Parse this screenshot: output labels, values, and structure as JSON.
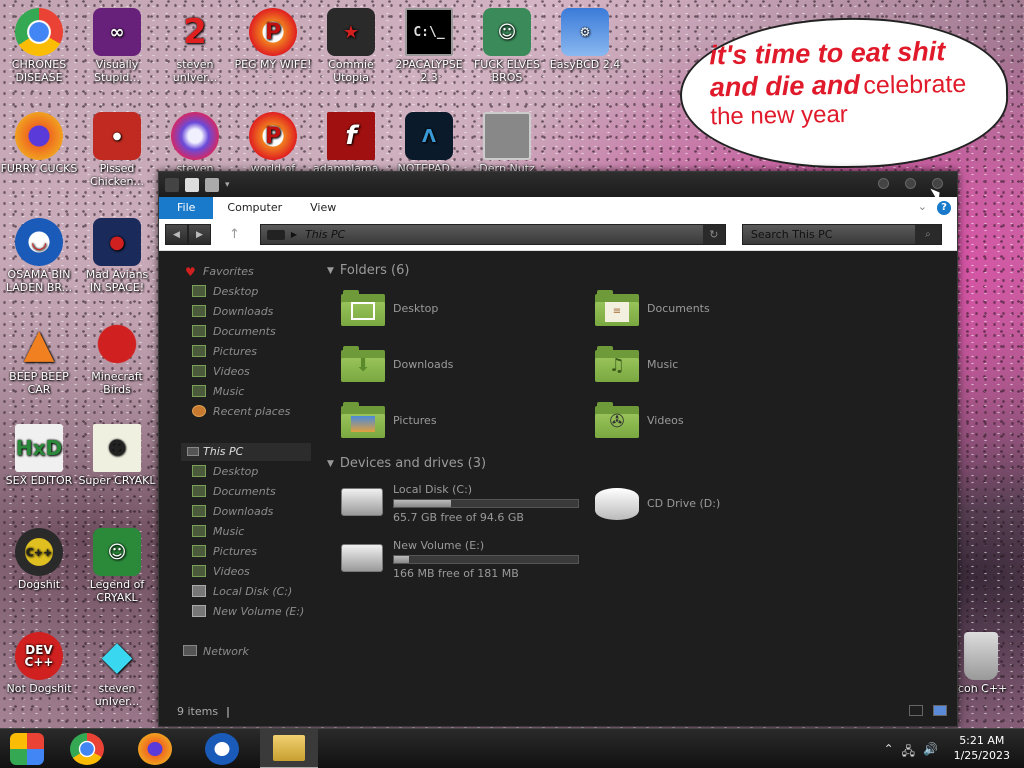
{
  "desktop": {
    "icons": [
      {
        "label": "CHRONES\nDISEASE",
        "icon": "chrome-icon"
      },
      {
        "label": "Visually\nStupid...",
        "icon": "visual-studio-icon"
      },
      {
        "label": "steven\nunIver...",
        "icon": "steven-icon"
      },
      {
        "label": "PEG MY WIFE!",
        "icon": "peggle-icon"
      },
      {
        "label": "Commie\nUtopia",
        "icon": "commie-utopia-icon"
      },
      {
        "label": "2PACALYPSE\n2.3",
        "icon": "terminal-icon"
      },
      {
        "label": "FUCK ELVES\nBROS",
        "icon": "elf-icon"
      },
      {
        "label": "EasyBCD 2.4",
        "icon": "easybcd-icon"
      },
      {
        "label": "FURRY CUCKS",
        "icon": "firefox-icon"
      },
      {
        "label": "Pissed\nChicken...",
        "icon": "angry-birds-seasons-icon"
      },
      {
        "label": "steven\nunIver...",
        "icon": "steven-gem-icon"
      },
      {
        "label": "world of\npe...",
        "icon": "world-of-peggle-icon"
      },
      {
        "label": "adamplama...",
        "icon": "flash-icon"
      },
      {
        "label": "NOTEPAD...",
        "icon": "notepad-icon"
      },
      {
        "label": "Derp Nutz",
        "icon": "derp-icon"
      },
      {
        "label": "OSAMA BIN\nLADEN BR...",
        "icon": "obama-icon"
      },
      {
        "label": "Mad Avians\nIN SPACE!",
        "icon": "angry-birds-space-icon"
      },
      {
        "label": "BEEP BEEP\nCAR",
        "icon": "vlc-icon"
      },
      {
        "label": "Minecraft\nBirds",
        "icon": "angry-birds-icon"
      },
      {
        "label": "SEX EDITOR",
        "icon": "hxd-icon"
      },
      {
        "label": "Super CRYAKL",
        "icon": "cryakl-icon"
      },
      {
        "label": "Dogshit",
        "icon": "dogshit-icon"
      },
      {
        "label": "Legend of\nCRYAKL",
        "icon": "legend-cryakl-icon"
      },
      {
        "label": "Not Dogshit",
        "icon": "devcpp-icon"
      },
      {
        "label": "steven\nunIver...",
        "icon": "diamond-icon"
      },
      {
        "label": "Icon C++",
        "icon": "recycle-bin-icon"
      }
    ],
    "bubble": {
      "line1": "it's time to eat shit",
      "line2a": "and die and",
      "line2b": "celebrate",
      "line3": "the new year"
    }
  },
  "explorer": {
    "ribbon": {
      "tabs": [
        "File",
        "Computer",
        "View"
      ]
    },
    "address": {
      "path": "This PC"
    },
    "search": {
      "placeholder": "Search This PC"
    },
    "nav": {
      "favorites_label": "Favorites",
      "favorites": [
        "Desktop",
        "Downloads",
        "Documents",
        "Pictures",
        "Videos",
        "Music",
        "Recent places"
      ],
      "thispc_label": "This PC",
      "thispc": [
        "Desktop",
        "Documents",
        "Downloads",
        "Music",
        "Pictures",
        "Videos",
        "Local Disk (C:)",
        "New Volume (E:)"
      ],
      "network_label": "Network"
    },
    "folders_header": "Folders (6)",
    "folders": [
      "Desktop",
      "Documents",
      "Downloads",
      "Music",
      "Pictures",
      "Videos"
    ],
    "drives_header": "Devices and drives (3)",
    "drives": [
      {
        "name": "Local Disk (C:)",
        "free": "65.7 GB free of 94.6 GB",
        "used_fraction": 0.31
      },
      {
        "name": "New Volume (E:)",
        "free": "166 MB free of 181 MB",
        "used_fraction": 0.08
      },
      {
        "name": "CD Drive (D:)"
      }
    ],
    "status": "9 items"
  },
  "taskbar": {
    "time": "5:21 AM",
    "date": "1/25/2023"
  }
}
